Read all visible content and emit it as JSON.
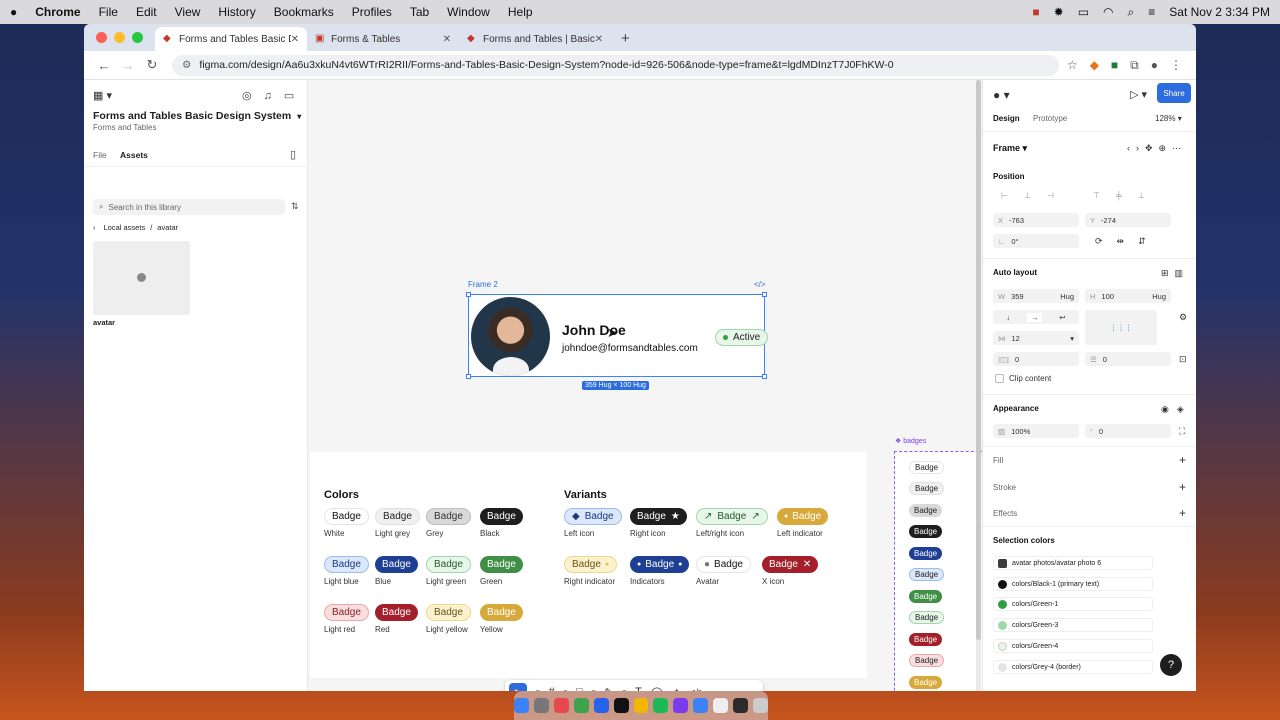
{
  "menubar": {
    "apple": "",
    "app": "Chrome",
    "items": [
      "File",
      "Edit",
      "View",
      "History",
      "Bookmarks",
      "Profiles",
      "Tab",
      "Window",
      "Help"
    ],
    "datetime": "Sat Nov 2  3:34 PM"
  },
  "tabs": [
    {
      "label": "Forms and Tables Basic Desig",
      "active": true
    },
    {
      "label": "Forms & Tables",
      "active": false
    },
    {
      "label": "Forms and Tables | Basic De",
      "active": false
    }
  ],
  "address": {
    "url": "figma.com/design/Aa6u3xkuN4vt6WTrRI2RII/Forms-and-Tables-Basic-Design-System?node-id=926-506&node-type=frame&t=lgdMDInzT7J0FhKW-0"
  },
  "left_panel": {
    "file_name": "Forms and Tables Basic Design System",
    "project": "Forms and Tables",
    "tab_file": "File",
    "tab_assets": "Assets",
    "search_placeholder": "Search in this library",
    "crumb_root": "Local assets",
    "crumb_sep": "/",
    "crumb_leaf": "avatar",
    "asset_label": "avatar"
  },
  "canvas": {
    "frame_label": "Frame 2",
    "code_icon_label": "</>",
    "name": "John Doe",
    "email": "johndoe@formsandtables.com",
    "status": "Active",
    "dimension": "359 Hug × 100 Hug",
    "colors_title": "Colors",
    "variants_title": "Variants",
    "badge_text": "Badge",
    "color_captions": [
      "White",
      "Light grey",
      "Grey",
      "Black",
      "Light blue",
      "Blue",
      "Light green",
      "Green",
      "Light red",
      "Red",
      "Light yellow",
      "Yellow"
    ],
    "variant_captions": [
      "Left icon",
      "Right icon",
      "Left/right icon",
      "Left indicator",
      "Right indicator",
      "Indicators",
      "Avatar",
      "X icon"
    ],
    "badges_label": "badges"
  },
  "right_panel": {
    "share": "Share",
    "tab_design": "Design",
    "tab_prototype": "Prototype",
    "zoom": "128%",
    "frame": "Frame",
    "position": "Position",
    "x_label": "X",
    "x_value": "-763",
    "y_label": "Y",
    "y_value": "-274",
    "rotation": "0°",
    "auto_layout": "Auto layout",
    "w_label": "W",
    "w_value": "359",
    "w_mode": "Hug",
    "h_label": "H",
    "h_value": "100",
    "h_mode": "Hug",
    "gap": "12",
    "pad_h": "0",
    "pad_v": "0",
    "clip": "Clip content",
    "appearance": "Appearance",
    "opacity": "100%",
    "radius": "0",
    "fill": "Fill",
    "stroke": "Stroke",
    "effects": "Effects",
    "selection_colors": "Selection colors",
    "swatches": [
      {
        "name": "avatar photos/avatar photo 6",
        "color": "#3b3b3b"
      },
      {
        "name": "colors/Black-1 (primary text)",
        "color": "#111111"
      },
      {
        "name": "colors/Green-1",
        "color": "#2f9e44"
      },
      {
        "name": "colors/Green-3",
        "color": "#9fd8a8"
      },
      {
        "name": "colors/Green-4",
        "color": "#e7f6e9"
      },
      {
        "name": "colors/Grey-4 (border)",
        "color": "#e5e5e5"
      }
    ],
    "help": "?"
  }
}
